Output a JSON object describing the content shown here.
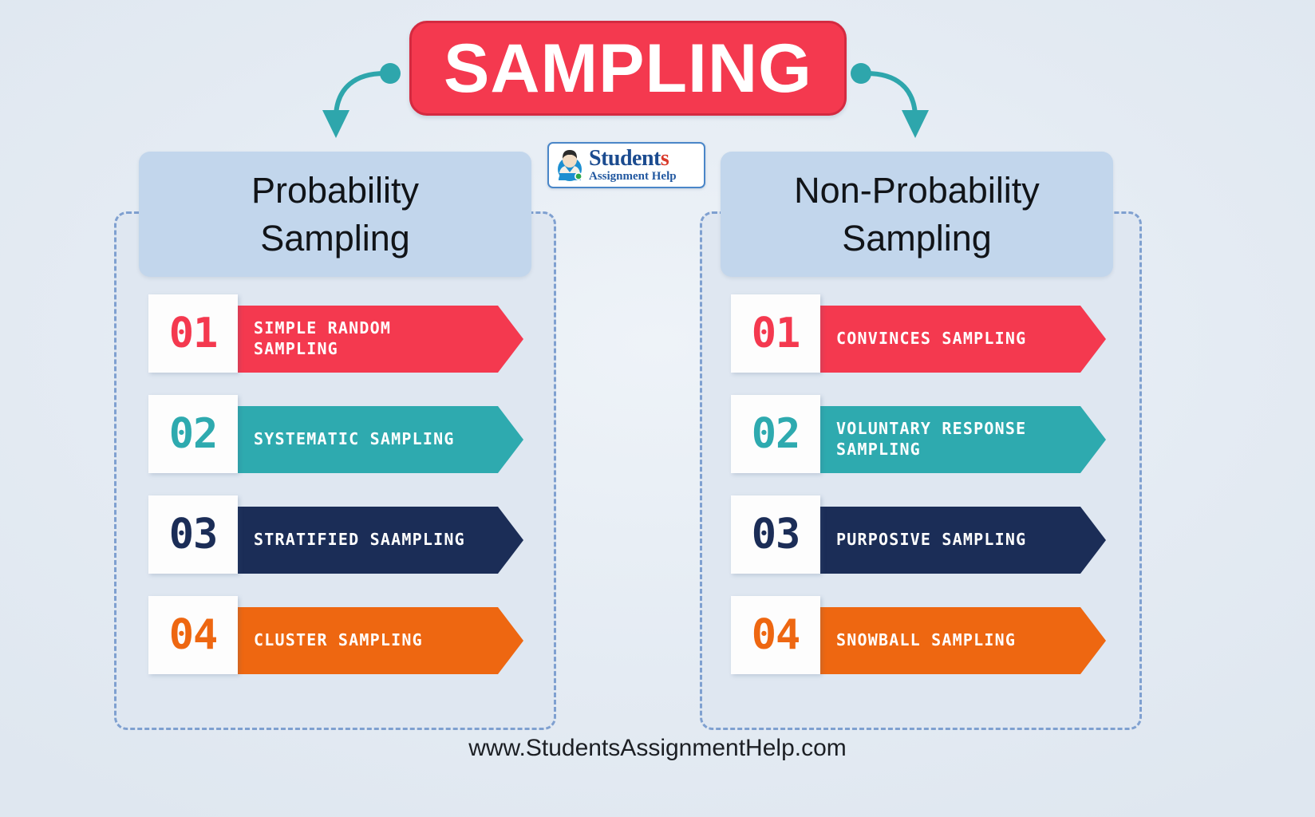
{
  "title": {
    "text": "SAMPLING",
    "banner_color": "#f4394f",
    "banner_border_color": "#d42a40",
    "text_color": "#ffffff"
  },
  "connectors": {
    "color": "#2ea6ac",
    "left_icon": "curved-arrow-down-left-icon",
    "right_icon": "curved-arrow-down-right-icon"
  },
  "logo": {
    "title_main": "Student",
    "title_tail": "s",
    "subtitle": "Assignment Help",
    "avatar_icon": "student-avatar-icon",
    "border_color": "#4a86c8",
    "title_color": "#1b4b8f",
    "tail_color": "#d93a2b",
    "subtitle_color": "#2258a0"
  },
  "panels": [
    {
      "id": "probability",
      "header": "Probability\nSampling",
      "header_bg": "#c2d6ec",
      "items": [
        {
          "number": "01",
          "label": "SIMPLE RANDOM SAMPLING",
          "color": "#f4394f",
          "shade": "#c3202f"
        },
        {
          "number": "02",
          "label": "SYSTEMATIC SAMPLING",
          "color": "#2eaaaf",
          "shade": "#1d7e83"
        },
        {
          "number": "03",
          "label": "STRATIFIED SAAMPLING",
          "color": "#1b2d57",
          "shade": "#0e1a36"
        },
        {
          "number": "04",
          "label": "CLUSTER SAMPLING",
          "color": "#ee6711",
          "shade": "#b94a08"
        }
      ]
    },
    {
      "id": "non-probability",
      "header": "Non-Probability\nSampling",
      "header_bg": "#c2d6ec",
      "items": [
        {
          "number": "01",
          "label": "CONVINCES SAMPLING",
          "color": "#f4394f",
          "shade": "#c3202f"
        },
        {
          "number": "02",
          "label": "VOLUNTARY RESPONSE\nSAMPLING",
          "color": "#2eaaaf",
          "shade": "#1d7e83"
        },
        {
          "number": "03",
          "label": "PURPOSIVE SAMPLING",
          "color": "#1b2d57",
          "shade": "#0e1a36"
        },
        {
          "number": "04",
          "label": "SNOWBALL SAMPLING",
          "color": "#ee6711",
          "shade": "#b94a08"
        }
      ]
    }
  ],
  "footer": {
    "url": "www.StudentsAssignmentHelp.com"
  },
  "background_color": "#e8eef5",
  "panel_border_color": "#7fa0d0"
}
